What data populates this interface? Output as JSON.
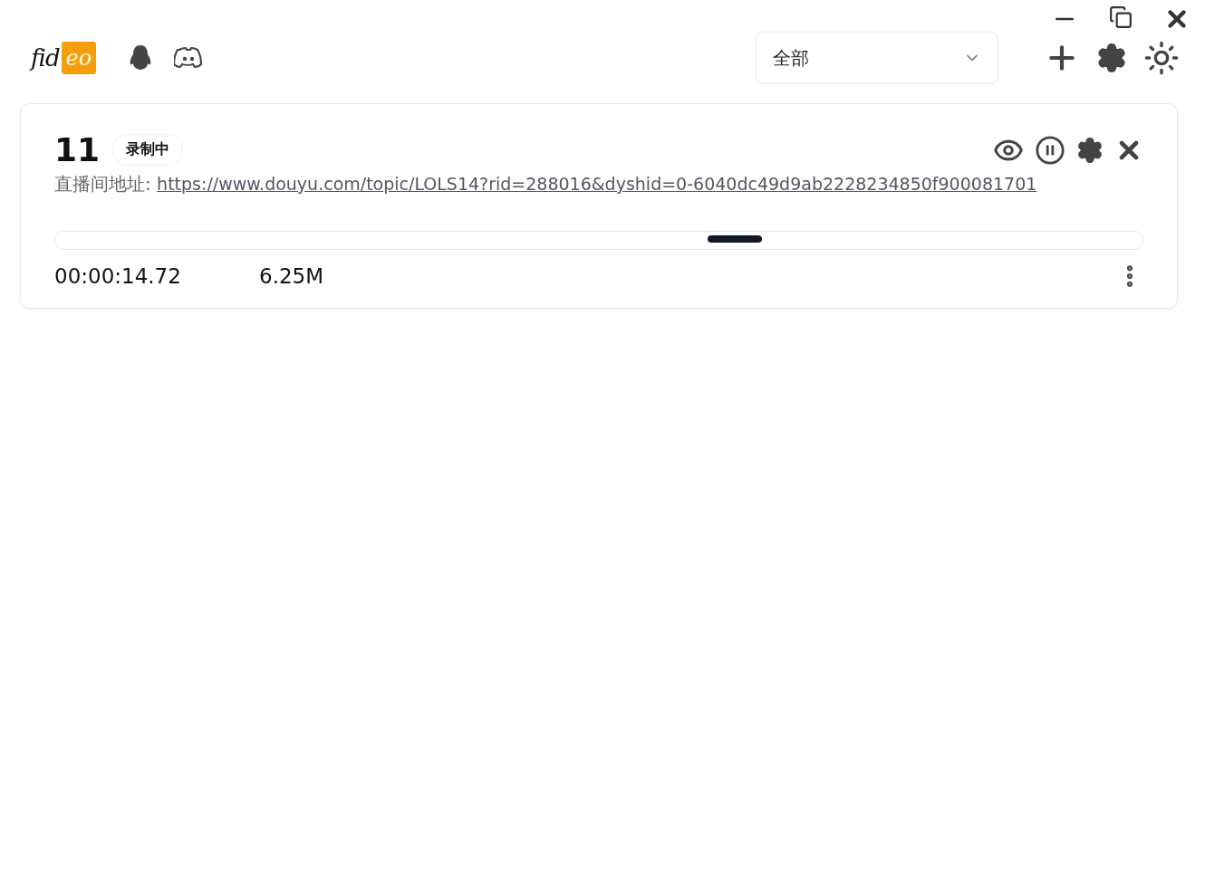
{
  "logo": {
    "text": "fid",
    "badge": "eo"
  },
  "filter": {
    "value": "全部"
  },
  "tasks": [
    {
      "name": "11",
      "status": "录制中",
      "url_label": "直播间地址: ",
      "url": "https://www.douyu.com/topic/LOLS14?rid=288016&dyshid=0-6040dc49d9ab2228234850f900081701",
      "indeterminate": true,
      "duration": "00:00:14.72",
      "size": "6.25M"
    }
  ]
}
